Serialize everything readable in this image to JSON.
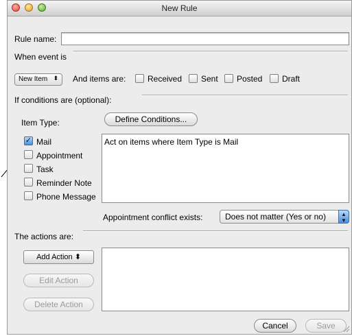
{
  "window": {
    "title": "New Rule"
  },
  "rule_name": {
    "label": "Rule name:",
    "value": ""
  },
  "when_event": {
    "heading": "When event is",
    "event_popup": "New Item",
    "and_items_label": "And items are:",
    "item_options": [
      "Received",
      "Sent",
      "Posted",
      "Draft"
    ]
  },
  "conditions": {
    "heading": "If conditions are  (optional):",
    "item_type_label": "Item Type:",
    "define_button": "Define Conditions...",
    "types": [
      {
        "label": "Mail",
        "checked": true
      },
      {
        "label": "Appointment",
        "checked": false
      },
      {
        "label": "Task",
        "checked": false
      },
      {
        "label": "Reminder Note",
        "checked": false
      },
      {
        "label": "Phone Message",
        "checked": false
      }
    ],
    "description": "Act on items where Item Type is Mail",
    "conflict_label": "Appointment conflict exists:",
    "conflict_value": "Does not matter (Yes or no)"
  },
  "actions": {
    "heading": "The actions are:",
    "add_button": "Add Action",
    "edit_button": "Edit Action",
    "delete_button": "Delete Action"
  },
  "footer": {
    "cancel": "Cancel",
    "save": "Save"
  },
  "glyphs": {
    "updown": "⬍",
    "check": "✓"
  }
}
